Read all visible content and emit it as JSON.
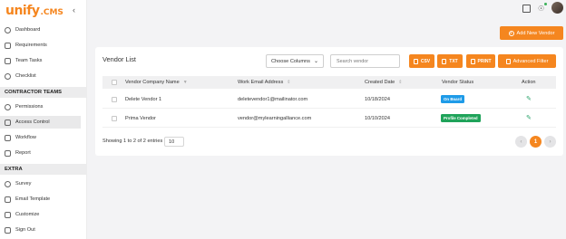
{
  "brand": {
    "logo_main": "unify",
    "logo_suffix": ".CMS",
    "accent": "#f5861f"
  },
  "sidebar": {
    "items_top": [
      {
        "label": "Dashboard",
        "icon": "gauge-icon"
      },
      {
        "label": "Requirements",
        "icon": "requirements-icon"
      },
      {
        "label": "Team Tasks",
        "icon": "tasks-icon"
      },
      {
        "label": "Checklist",
        "icon": "checklist-icon"
      }
    ],
    "section_contractor": "CONTRACTOR TEAMS",
    "items_contractor": [
      {
        "label": "Permissions",
        "icon": "permissions-icon"
      },
      {
        "label": "Access Control",
        "icon": "access-control-icon",
        "active": true
      },
      {
        "label": "Workflow",
        "icon": "workflow-icon"
      },
      {
        "label": "Report",
        "icon": "report-icon"
      }
    ],
    "section_extra": "EXTRA",
    "items_extra": [
      {
        "label": "Survey",
        "icon": "survey-icon"
      },
      {
        "label": "Email Template",
        "icon": "email-icon"
      },
      {
        "label": "Customize",
        "icon": "customize-icon"
      },
      {
        "label": "Sign Out",
        "icon": "sign-out-icon"
      }
    ]
  },
  "header": {
    "add_button": "Add New Vendor"
  },
  "card": {
    "title": "Vendor List",
    "choose_columns": "Choose Columns",
    "search_placeholder": "Search vendor",
    "btn_csv": "CSV",
    "btn_txt": "TXT",
    "btn_print": "PRINT",
    "btn_filter": "Advanced Filter"
  },
  "table": {
    "columns": [
      "Vendor Company Name",
      "Work Email Address",
      "Created Date",
      "Vendor Status",
      "Action"
    ],
    "rows": [
      {
        "name": "Delete Vendor 1",
        "email": "deletevendor1@mailinator.com",
        "date": "10/18/2024",
        "status": "On Board",
        "status_color": "#1e9be8"
      },
      {
        "name": "Prima Vendor",
        "email": "vendor@mylearningalliance.com",
        "date": "10/10/2024",
        "status": "Profile Completed",
        "status_color": "#1fa35a"
      }
    ]
  },
  "footer": {
    "showing": "Showing 1 to 2 of 2 entries",
    "page_size": "10",
    "current_page": "1",
    "prev": "‹",
    "next": "›"
  }
}
